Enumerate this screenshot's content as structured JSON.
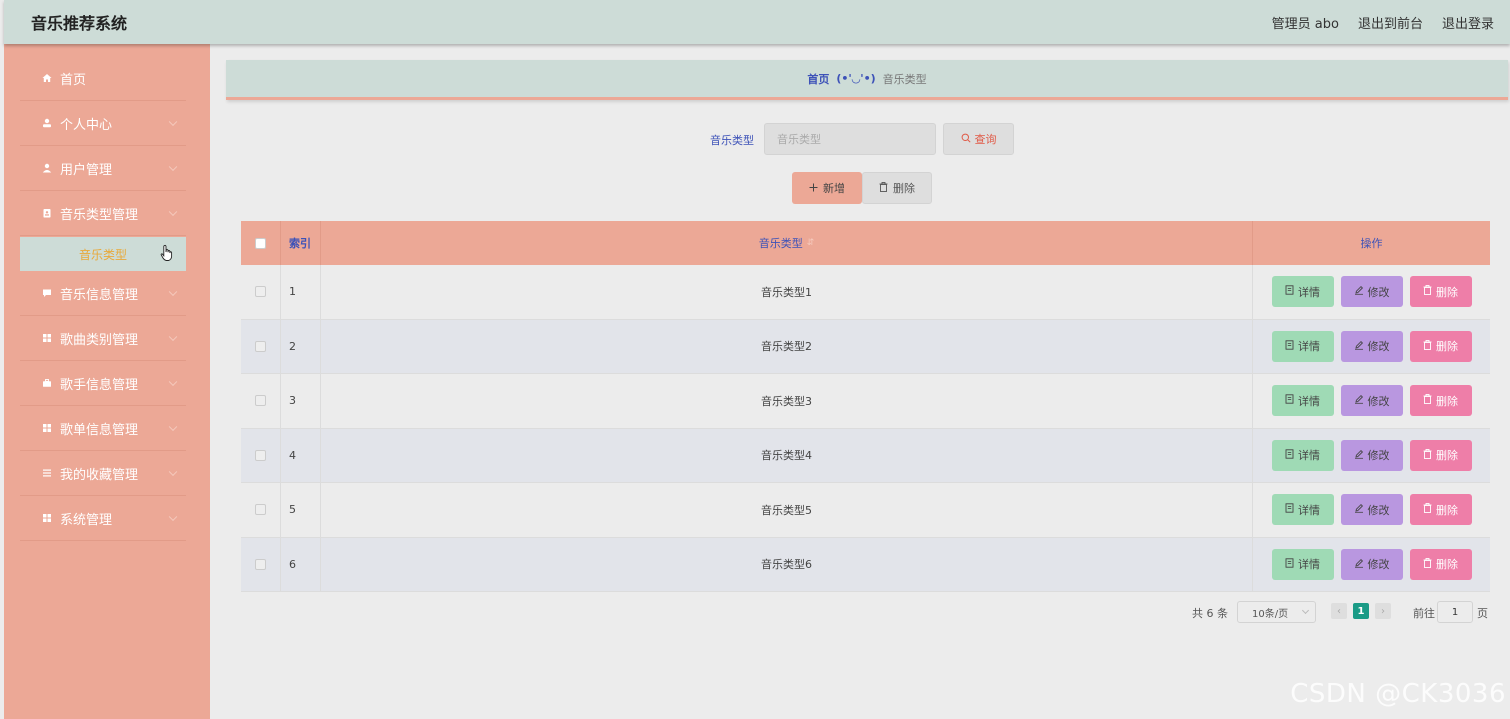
{
  "header": {
    "title": "音乐推荐系统",
    "user": "管理员 abo",
    "back_frontend": "退出到前台",
    "logout": "退出登录"
  },
  "sidebar": {
    "items": [
      {
        "label": "首页",
        "icon": "home-icon",
        "expandable": false
      },
      {
        "label": "个人中心",
        "icon": "person-icon",
        "expandable": true
      },
      {
        "label": "用户管理",
        "icon": "user-icon",
        "expandable": true
      },
      {
        "label": "音乐类型管理",
        "icon": "badge-icon",
        "expandable": true
      },
      {
        "label": "音乐信息管理",
        "icon": "chat-icon",
        "expandable": true
      },
      {
        "label": "歌曲类别管理",
        "icon": "grid-icon",
        "expandable": true
      },
      {
        "label": "歌手信息管理",
        "icon": "briefcase-icon",
        "expandable": true
      },
      {
        "label": "歌单信息管理",
        "icon": "grid-icon",
        "expandable": true
      },
      {
        "label": "我的收藏管理",
        "icon": "list-icon",
        "expandable": true
      },
      {
        "label": "系统管理",
        "icon": "grid-icon",
        "expandable": true
      }
    ],
    "active_sub": "音乐类型"
  },
  "breadcrumb": {
    "home": "首页",
    "separator": "(•'◡'•)",
    "current": "音乐类型"
  },
  "search": {
    "label": "音乐类型",
    "placeholder": "音乐类型",
    "button": "查询"
  },
  "toolbar": {
    "add": "新增",
    "delete": "删除"
  },
  "table": {
    "columns": {
      "index": "索引",
      "name": "音乐类型",
      "ops": "操作"
    },
    "rows": [
      {
        "index": "1",
        "name": "音乐类型1"
      },
      {
        "index": "2",
        "name": "音乐类型2"
      },
      {
        "index": "3",
        "name": "音乐类型3"
      },
      {
        "index": "4",
        "name": "音乐类型4"
      },
      {
        "index": "5",
        "name": "音乐类型5"
      },
      {
        "index": "6",
        "name": "音乐类型6"
      }
    ],
    "actions": {
      "detail": "详情",
      "edit": "修改",
      "remove": "删除"
    }
  },
  "pagination": {
    "total": "共 6 条",
    "page_size": "10条/页",
    "current": "1",
    "goto_label": "前往",
    "goto_value": "1",
    "page_suffix": "页"
  },
  "watermark": "CSDN @CK3036",
  "colors": {
    "header_bg": "#cddcd7",
    "sidebar_bg": "#eca896",
    "accent_blue": "#3d52b8",
    "detail_btn": "#9fdab5",
    "edit_btn": "#b997e0",
    "remove_btn": "#ee7ea8",
    "pager_active": "#1a9b86"
  }
}
